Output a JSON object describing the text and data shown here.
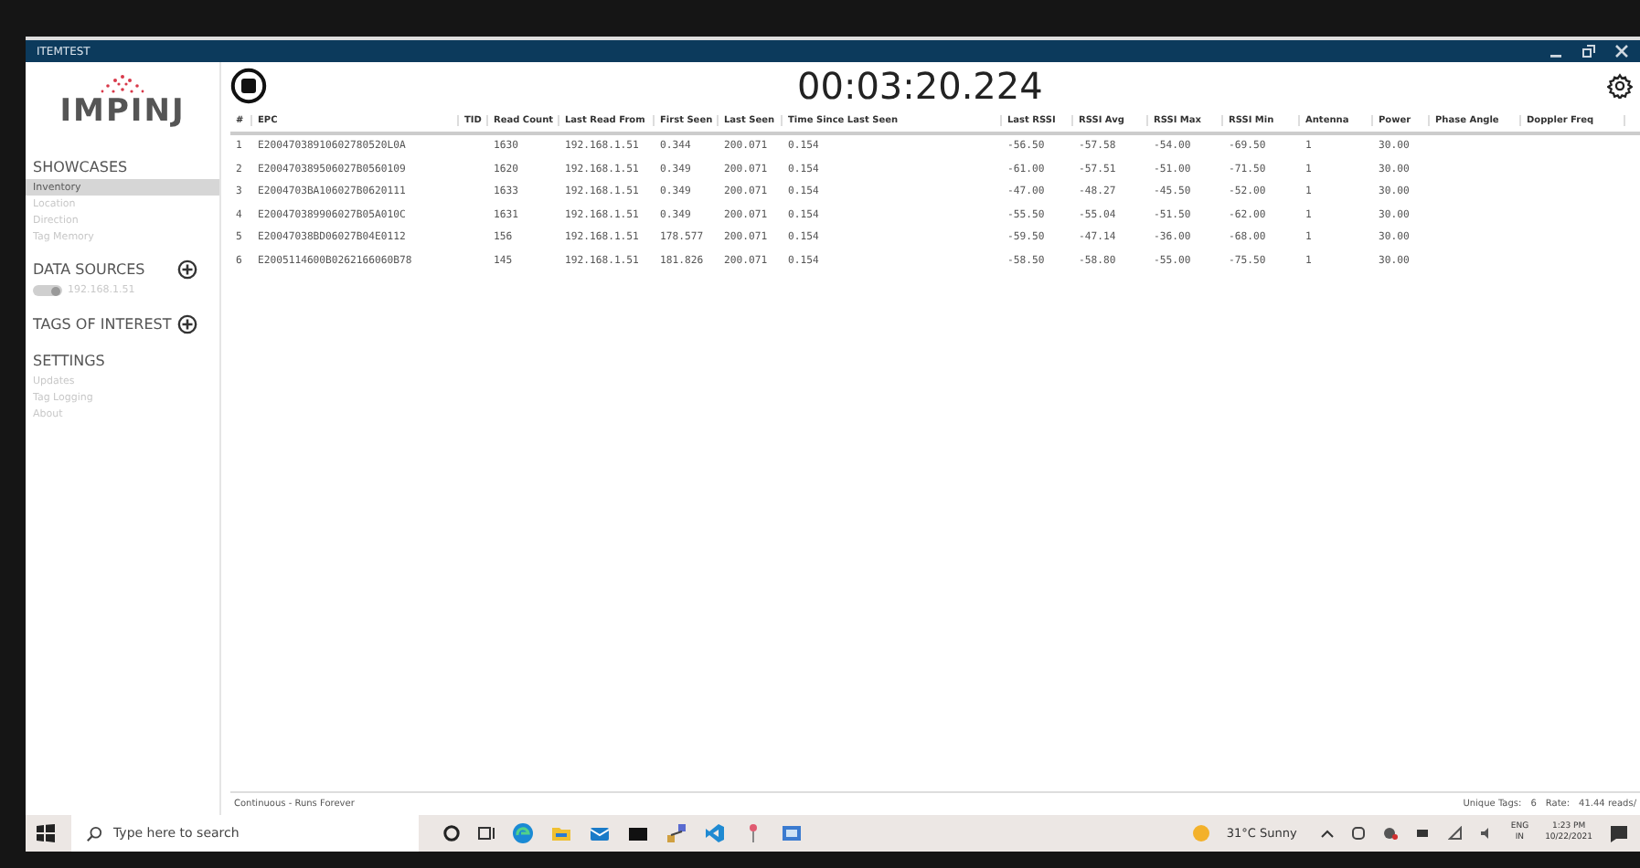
{
  "window": {
    "title": "ITEMTEST"
  },
  "logo": {
    "text": "IMPINJ"
  },
  "sidebar": {
    "sections": [
      {
        "title": "SHOWCASES",
        "add_button": false,
        "items": [
          {
            "label": "Inventory",
            "selected": true
          },
          {
            "label": "Location",
            "selected": false
          },
          {
            "label": "Direction",
            "selected": false
          },
          {
            "label": "Tag Memory",
            "selected": false
          }
        ]
      },
      {
        "title": "DATA SOURCES",
        "add_button": true,
        "sources": [
          {
            "label": "192.168.1.51",
            "on": true
          }
        ]
      },
      {
        "title": "TAGS OF INTEREST",
        "add_button": true
      },
      {
        "title": "SETTINGS",
        "add_button": false,
        "items": [
          {
            "label": "Updates",
            "selected": false
          },
          {
            "label": "Tag Logging",
            "selected": false
          },
          {
            "label": "About",
            "selected": false
          }
        ]
      }
    ]
  },
  "timer": "00:03:20.224",
  "running": true,
  "table": {
    "columns": [
      "#",
      "EPC",
      "TID",
      "Read Count",
      "Last Read From",
      "First Seen",
      "Last Seen",
      "Time Since Last Seen",
      "Last RSSI",
      "RSSI Avg",
      "RSSI Max",
      "RSSI Min",
      "Antenna",
      "Power",
      "Phase Angle",
      "Doppler Freq"
    ],
    "rows": [
      [
        "1",
        "E20047038910602780520L0A",
        "",
        "1630",
        "192.168.1.51",
        "0.344",
        "200.071",
        "0.154",
        "-56.50",
        "-57.58",
        "-54.00",
        "-69.50",
        "1",
        "30.00",
        "",
        ""
      ],
      [
        "2",
        "E200470389506027B0560109",
        "",
        "1620",
        "192.168.1.51",
        "0.349",
        "200.071",
        "0.154",
        "-61.00",
        "-57.51",
        "-51.00",
        "-71.50",
        "1",
        "30.00",
        "",
        ""
      ],
      [
        "3",
        "E2004703BA106027B0620111",
        "",
        "1633",
        "192.168.1.51",
        "0.349",
        "200.071",
        "0.154",
        "-47.00",
        "-48.27",
        "-45.50",
        "-52.00",
        "1",
        "30.00",
        "",
        ""
      ],
      [
        "4",
        "E200470389906027B05A010C",
        "",
        "1631",
        "192.168.1.51",
        "0.349",
        "200.071",
        "0.154",
        "-55.50",
        "-55.04",
        "-51.50",
        "-62.00",
        "1",
        "30.00",
        "",
        ""
      ],
      [
        "5",
        "E20047038BD06027B04E0112",
        "",
        "156",
        "192.168.1.51",
        "178.577",
        "200.071",
        "0.154",
        "-59.50",
        "-47.14",
        "-36.00",
        "-68.00",
        "1",
        "30.00",
        "",
        ""
      ],
      [
        "6",
        "E2005114600B0262166060B78",
        "",
        "145",
        "192.168.1.51",
        "181.826",
        "200.071",
        "0.154",
        "-58.50",
        "-58.80",
        "-55.00",
        "-75.50",
        "1",
        "30.00",
        "",
        ""
      ]
    ]
  },
  "status_bar": {
    "mode": "Continuous - Runs Forever",
    "unique_tags_label": "Unique Tags:",
    "unique_tags": "6",
    "rate_label": "Rate:",
    "rate": "41.44 reads/"
  },
  "taskbar": {
    "search": {
      "placeholder": "Type here to search"
    },
    "weather": "31°C Sunny",
    "language": "ENG",
    "region": "IN",
    "time": "1:23 PM",
    "date": "10/22/2021"
  }
}
